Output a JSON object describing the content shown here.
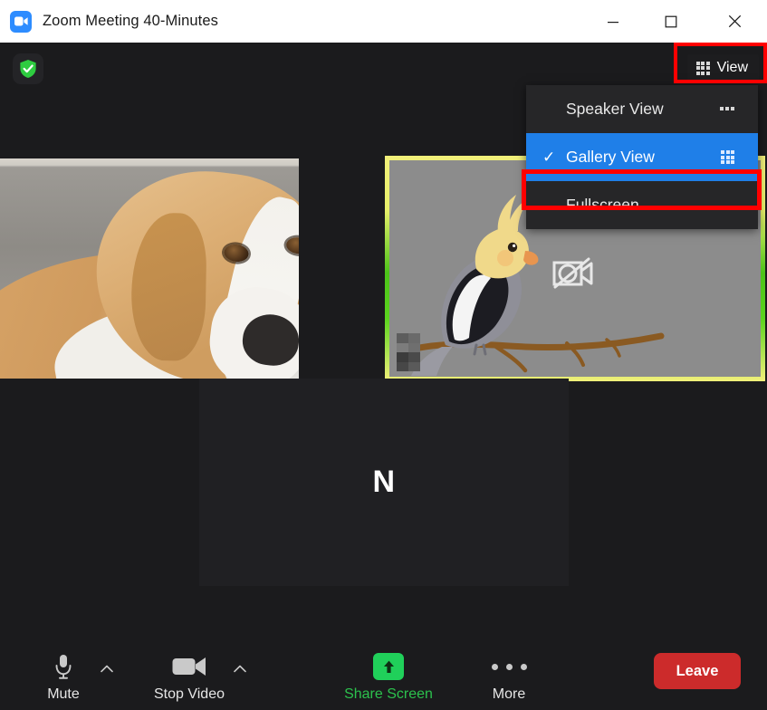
{
  "window": {
    "title": "Zoom Meeting 40-Minutes",
    "app_icon": "zoom-camera-icon",
    "controls": {
      "minimize": "minimize-icon",
      "maximize": "maximize-icon",
      "close": "close-icon"
    },
    "titlebar_bg": "#ffffff"
  },
  "meeting": {
    "background": "#1b1b1d",
    "security_badge": {
      "icon": "shield-check-icon",
      "color": "#2ecc40"
    },
    "view_button": {
      "label": "View",
      "icon": "grid-3x3-icon",
      "annotated": true,
      "annotation_color": "#ff0000"
    },
    "view_menu": {
      "background": "#262628",
      "items": [
        {
          "label": "Speaker View",
          "icon": "speaker-view-icon",
          "selected": false,
          "check": "",
          "annotated": false
        },
        {
          "label": "Gallery View",
          "icon": "grid-3x3-icon",
          "selected": true,
          "check": "✓",
          "annotated": true,
          "highlight_color": "#1f7fe8",
          "annotation_color": "#ff0000"
        },
        {
          "label": "Fullscreen",
          "icon": "",
          "selected": false,
          "check": "",
          "annotated": false
        }
      ]
    },
    "tiles": [
      {
        "id": "tile-dog",
        "content": "dog-photo",
        "name_label": "censored",
        "active_speaker": false,
        "video_on": true
      },
      {
        "id": "tile-bird",
        "content": "cockatiel-illustration",
        "name_label": "censored",
        "active_speaker": true,
        "video_on": false,
        "status_icon": "camera-off-icon",
        "border_colors": [
          "#f2f07a",
          "#4cc319"
        ]
      },
      {
        "id": "tile-avatar",
        "content": "avatar-initial",
        "initial": "N",
        "active_speaker": false,
        "video_on": false
      }
    ]
  },
  "toolbar": {
    "background": "#1b1b1d",
    "items": [
      {
        "label": "Mute",
        "icon": "microphone-icon",
        "has_caret": true,
        "caret": "chevron-up-icon",
        "color": "#e6e6e6"
      },
      {
        "label": "Stop Video",
        "icon": "video-camera-icon",
        "has_caret": true,
        "caret": "chevron-up-icon",
        "color": "#e6e6e6"
      },
      {
        "label": "Share Screen",
        "icon": "share-screen-icon",
        "has_caret": false,
        "caret": "",
        "color": "#2cc14d"
      },
      {
        "label": "More",
        "icon": "ellipsis-icon",
        "has_caret": false,
        "caret": "",
        "color": "#e6e6e6"
      }
    ],
    "leave_button": {
      "label": "Leave",
      "color": "#cc2b2b"
    }
  }
}
